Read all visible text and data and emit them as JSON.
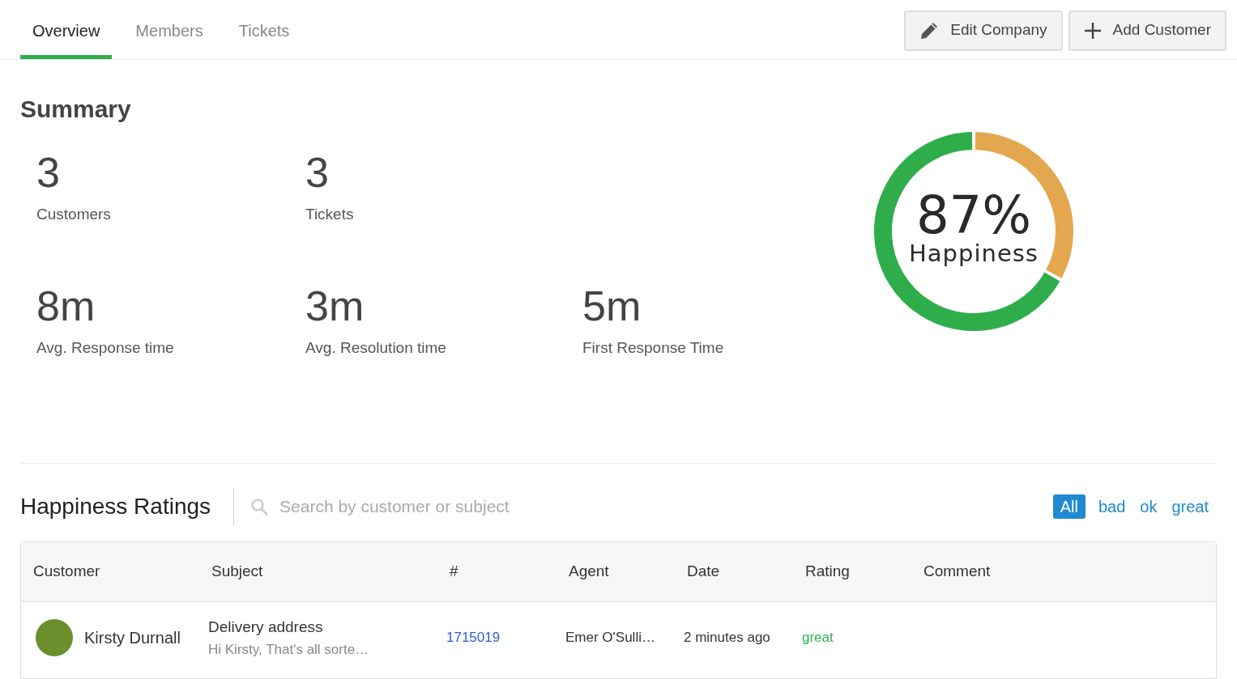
{
  "tabs": [
    {
      "label": "Overview",
      "selected": true
    },
    {
      "label": "Members",
      "selected": false
    },
    {
      "label": "Tickets",
      "selected": false
    }
  ],
  "actions": [
    {
      "kind": "edit",
      "label": "Edit Company"
    },
    {
      "kind": "add",
      "label": "Add Customer"
    }
  ],
  "summary": {
    "title": "Summary",
    "stats": [
      {
        "value": "3",
        "label": "Customers"
      },
      {
        "value": "3",
        "label": "Tickets"
      },
      {
        "value": "8m",
        "label": "Avg. Response time"
      },
      {
        "value": "3m",
        "label": "Avg. Resolution time"
      },
      {
        "value": "5m",
        "label": "First Response Time"
      }
    ],
    "happiness": {
      "value": "87%",
      "label": "Happiness"
    }
  },
  "ratings": {
    "title": "Happiness Ratings",
    "search": {
      "placeholder": "Search by customer or subject"
    },
    "filters": [
      {
        "label": "All",
        "selected": true
      },
      {
        "label": "bad",
        "selected": false
      },
      {
        "label": "ok",
        "selected": false
      },
      {
        "label": "great",
        "selected": false
      }
    ],
    "table": {
      "columns": [
        "Customer",
        "Subject",
        "#",
        "Agent",
        "Date",
        "Rating",
        "Comment"
      ],
      "rows": [
        {
          "customer": "Kirsty Durnall",
          "subject": "Delivery address",
          "preview": "Hi Kirsty, That's all sorte…",
          "number": "1715019",
          "agent": "Emer O'Sulli…",
          "date": "2 minutes ago",
          "rating": "great",
          "comment": ""
        }
      ]
    }
  }
}
